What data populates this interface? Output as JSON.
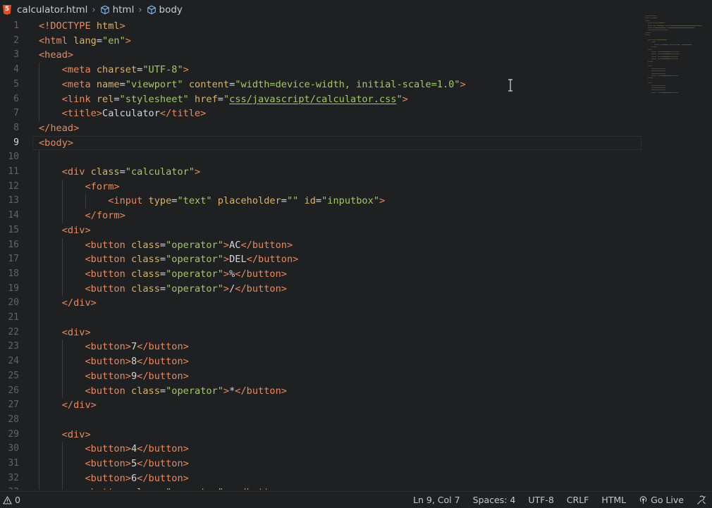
{
  "breadcrumb": {
    "file_badge": "5",
    "file": "calculator.html",
    "items": [
      "html",
      "body"
    ]
  },
  "editor": {
    "active_line": 9,
    "lines": [
      [
        [
          "t-tag",
          "<!DOCTYPE "
        ],
        [
          "t-attr",
          "html"
        ],
        [
          "t-tag",
          ">"
        ]
      ],
      [
        [
          "t-tag",
          "<html "
        ],
        [
          "t-attr",
          "lang"
        ],
        [
          "t-text",
          "="
        ],
        [
          "t-str",
          "\"en\""
        ],
        [
          "t-tag",
          ">"
        ]
      ],
      [
        [
          "t-tag",
          "<head>"
        ]
      ],
      [
        [
          "t-text",
          "    "
        ],
        [
          "t-tag",
          "<meta "
        ],
        [
          "t-attr",
          "charset"
        ],
        [
          "t-text",
          "="
        ],
        [
          "t-str",
          "\"UTF-8\""
        ],
        [
          "t-tag",
          ">"
        ]
      ],
      [
        [
          "t-text",
          "    "
        ],
        [
          "t-tag",
          "<meta "
        ],
        [
          "t-attr",
          "name"
        ],
        [
          "t-text",
          "="
        ],
        [
          "t-str",
          "\"viewport\""
        ],
        [
          "t-text",
          " "
        ],
        [
          "t-attr",
          "content"
        ],
        [
          "t-text",
          "="
        ],
        [
          "t-str",
          "\"width=device-width, initial-scale=1.0\""
        ],
        [
          "t-tag",
          ">"
        ]
      ],
      [
        [
          "t-text",
          "    "
        ],
        [
          "t-tag",
          "<link "
        ],
        [
          "t-attr",
          "rel"
        ],
        [
          "t-text",
          "="
        ],
        [
          "t-str",
          "\"stylesheet\""
        ],
        [
          "t-text",
          " "
        ],
        [
          "t-attr",
          "href"
        ],
        [
          "t-text",
          "="
        ],
        [
          "t-str",
          "\""
        ],
        [
          "t-link",
          "css/javascript/calculator.css"
        ],
        [
          "t-str",
          "\""
        ],
        [
          "t-tag",
          ">"
        ]
      ],
      [
        [
          "t-text",
          "    "
        ],
        [
          "t-tag",
          "<title>"
        ],
        [
          "t-text",
          "Calculator"
        ],
        [
          "t-tag",
          "</title>"
        ]
      ],
      [
        [
          "t-tag",
          "</head>"
        ]
      ],
      [
        [
          "t-tag",
          "<body>"
        ]
      ],
      [],
      [
        [
          "t-text",
          "    "
        ],
        [
          "t-tag",
          "<div "
        ],
        [
          "t-attr",
          "class"
        ],
        [
          "t-text",
          "="
        ],
        [
          "t-str",
          "\"calculator\""
        ],
        [
          "t-tag",
          ">"
        ]
      ],
      [
        [
          "t-text",
          "        "
        ],
        [
          "t-tag",
          "<form>"
        ]
      ],
      [
        [
          "t-text",
          "            "
        ],
        [
          "t-tag",
          "<input "
        ],
        [
          "t-attr",
          "type"
        ],
        [
          "t-text",
          "="
        ],
        [
          "t-str",
          "\"text\""
        ],
        [
          "t-text",
          " "
        ],
        [
          "t-attr",
          "placeholder"
        ],
        [
          "t-text",
          "="
        ],
        [
          "t-str",
          "\"\""
        ],
        [
          "t-text",
          " "
        ],
        [
          "t-attr",
          "id"
        ],
        [
          "t-text",
          "="
        ],
        [
          "t-str",
          "\"inputbox\""
        ],
        [
          "t-tag",
          ">"
        ]
      ],
      [
        [
          "t-text",
          "        "
        ],
        [
          "t-tag",
          "</form>"
        ]
      ],
      [
        [
          "t-text",
          "    "
        ],
        [
          "t-tag",
          "<div>"
        ]
      ],
      [
        [
          "t-text",
          "        "
        ],
        [
          "t-tag",
          "<button "
        ],
        [
          "t-attr",
          "class"
        ],
        [
          "t-text",
          "="
        ],
        [
          "t-str",
          "\"operator\""
        ],
        [
          "t-tag",
          ">"
        ],
        [
          "t-text",
          "AC"
        ],
        [
          "t-tag",
          "</button>"
        ]
      ],
      [
        [
          "t-text",
          "        "
        ],
        [
          "t-tag",
          "<button "
        ],
        [
          "t-attr",
          "class"
        ],
        [
          "t-text",
          "="
        ],
        [
          "t-str",
          "\"operator\""
        ],
        [
          "t-tag",
          ">"
        ],
        [
          "t-text",
          "DEL"
        ],
        [
          "t-tag",
          "</button>"
        ]
      ],
      [
        [
          "t-text",
          "        "
        ],
        [
          "t-tag",
          "<button "
        ],
        [
          "t-attr",
          "class"
        ],
        [
          "t-text",
          "="
        ],
        [
          "t-str",
          "\"operator\""
        ],
        [
          "t-tag",
          ">"
        ],
        [
          "t-text",
          "%"
        ],
        [
          "t-tag",
          "</button>"
        ]
      ],
      [
        [
          "t-text",
          "        "
        ],
        [
          "t-tag",
          "<button "
        ],
        [
          "t-attr",
          "class"
        ],
        [
          "t-text",
          "="
        ],
        [
          "t-str",
          "\"operator\""
        ],
        [
          "t-tag",
          ">"
        ],
        [
          "t-text",
          "/"
        ],
        [
          "t-tag",
          "</button>"
        ]
      ],
      [
        [
          "t-text",
          "    "
        ],
        [
          "t-tag",
          "</div>"
        ]
      ],
      [],
      [
        [
          "t-text",
          "    "
        ],
        [
          "t-tag",
          "<div>"
        ]
      ],
      [
        [
          "t-text",
          "        "
        ],
        [
          "t-tag",
          "<button>"
        ],
        [
          "t-text",
          "7"
        ],
        [
          "t-tag",
          "</button>"
        ]
      ],
      [
        [
          "t-text",
          "        "
        ],
        [
          "t-tag",
          "<button>"
        ],
        [
          "t-text",
          "8"
        ],
        [
          "t-tag",
          "</button>"
        ]
      ],
      [
        [
          "t-text",
          "        "
        ],
        [
          "t-tag",
          "<button>"
        ],
        [
          "t-text",
          "9"
        ],
        [
          "t-tag",
          "</button>"
        ]
      ],
      [
        [
          "t-text",
          "        "
        ],
        [
          "t-tag",
          "<button "
        ],
        [
          "t-attr",
          "class"
        ],
        [
          "t-text",
          "="
        ],
        [
          "t-str",
          "\"operator\""
        ],
        [
          "t-tag",
          ">"
        ],
        [
          "t-text",
          "*"
        ],
        [
          "t-tag",
          "</button>"
        ]
      ],
      [
        [
          "t-text",
          "    "
        ],
        [
          "t-tag",
          "</div>"
        ]
      ],
      [],
      [
        [
          "t-text",
          "    "
        ],
        [
          "t-tag",
          "<div>"
        ]
      ],
      [
        [
          "t-text",
          "        "
        ],
        [
          "t-tag",
          "<button>"
        ],
        [
          "t-text",
          "4"
        ],
        [
          "t-tag",
          "</button>"
        ]
      ],
      [
        [
          "t-text",
          "        "
        ],
        [
          "t-tag",
          "<button>"
        ],
        [
          "t-text",
          "5"
        ],
        [
          "t-tag",
          "</button>"
        ]
      ],
      [
        [
          "t-text",
          "        "
        ],
        [
          "t-tag",
          "<button>"
        ],
        [
          "t-text",
          "6"
        ],
        [
          "t-tag",
          "</button>"
        ]
      ],
      [
        [
          "t-text",
          "        "
        ],
        [
          "t-tag",
          "<button "
        ],
        [
          "t-attr",
          "class"
        ],
        [
          "t-text",
          "="
        ],
        [
          "t-str",
          "\"operator\""
        ],
        [
          "t-tag",
          ">"
        ],
        [
          "t-text",
          "-"
        ],
        [
          "t-tag",
          "</button>"
        ]
      ]
    ]
  },
  "statusbar": {
    "problems_count": "0",
    "position": "Ln 9, Col 7",
    "spaces": "Spaces: 4",
    "encoding": "UTF-8",
    "eol": "CRLF",
    "language": "HTML",
    "go_live": "Go Live"
  }
}
